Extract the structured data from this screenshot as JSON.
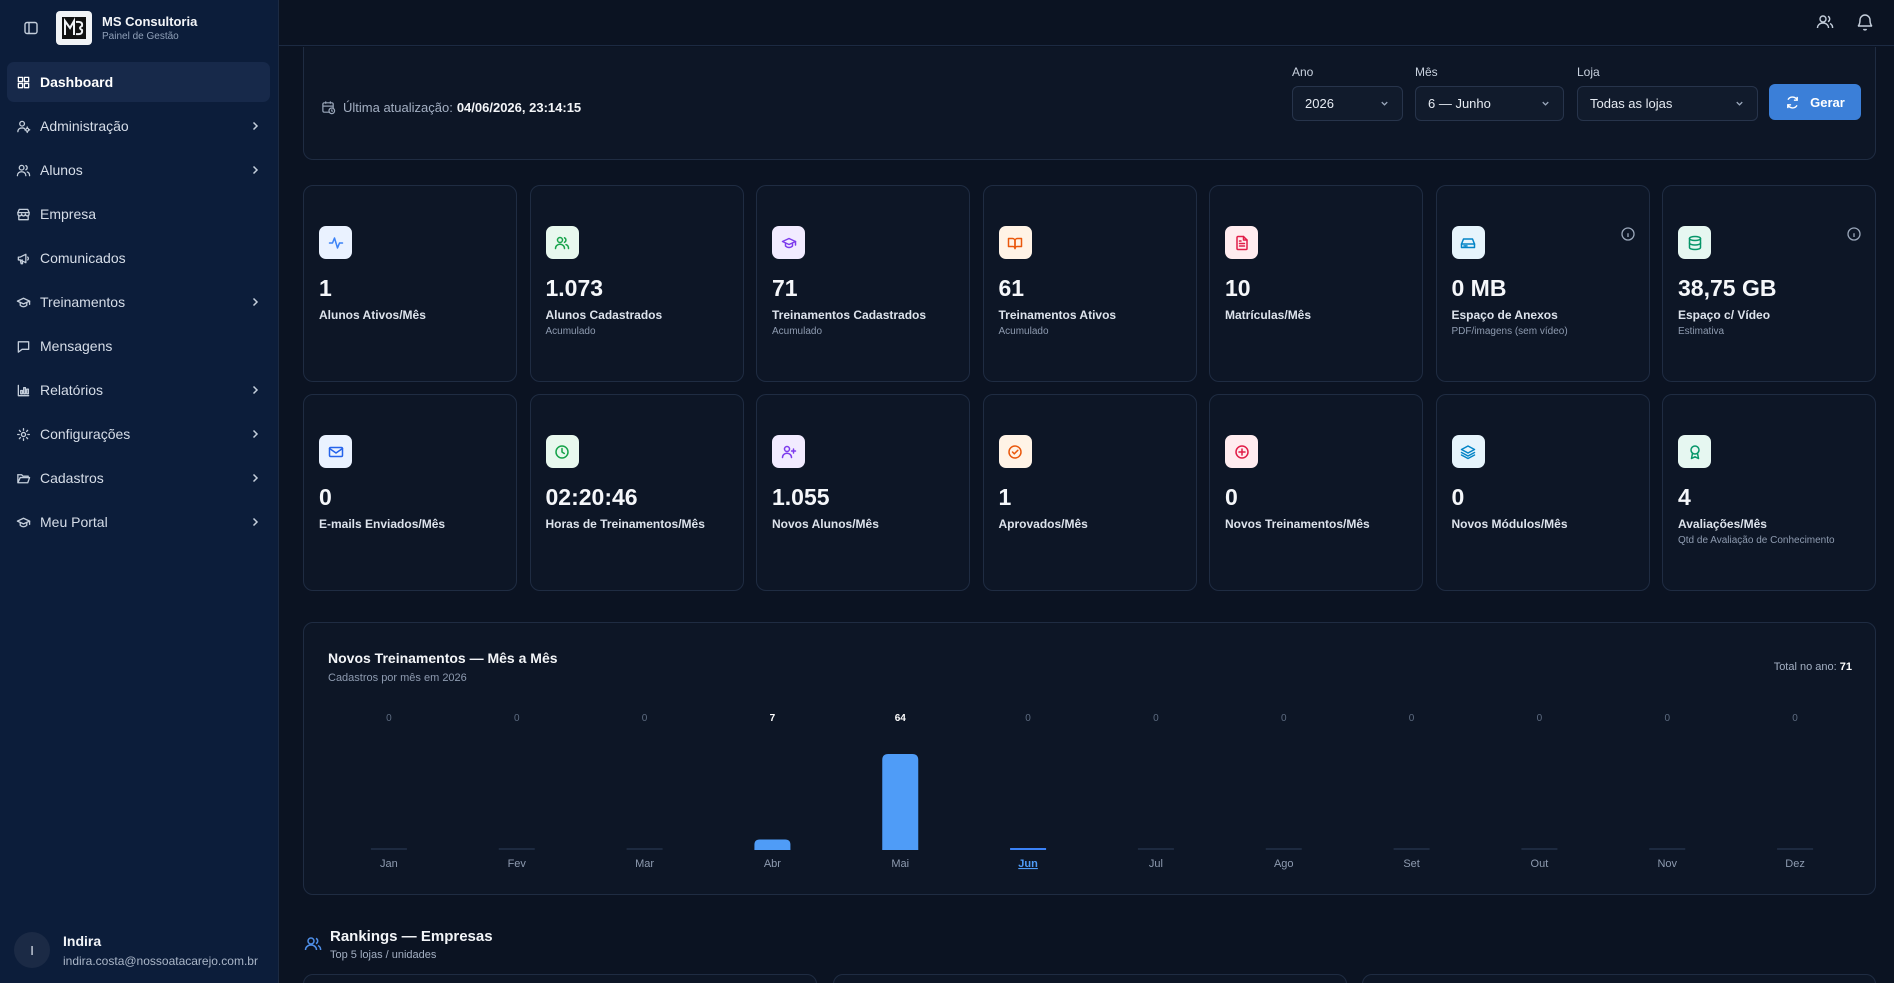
{
  "brand": {
    "title": "MS Consultoria",
    "subtitle": "Painel de Gestão"
  },
  "nav": [
    {
      "label": "Dashboard",
      "icon": "grid-icon",
      "active": true,
      "chevron": false
    },
    {
      "label": "Administração",
      "icon": "user-cog-icon",
      "chevron": true
    },
    {
      "label": "Alunos",
      "icon": "users-icon",
      "chevron": true
    },
    {
      "label": "Empresa",
      "icon": "store-icon",
      "chevron": false
    },
    {
      "label": "Comunicados",
      "icon": "megaphone-icon",
      "chevron": false
    },
    {
      "label": "Treinamentos",
      "icon": "graduation-cap-icon",
      "chevron": true
    },
    {
      "label": "Mensagens",
      "icon": "message-square-icon",
      "chevron": false
    },
    {
      "label": "Relatórios",
      "icon": "bar-chart-icon",
      "chevron": true
    },
    {
      "label": "Configurações",
      "icon": "gear-icon",
      "chevron": true
    },
    {
      "label": "Cadastros",
      "icon": "folder-open-icon",
      "chevron": true
    },
    {
      "label": "Meu Portal",
      "icon": "graduation-cap-icon",
      "chevron": true
    }
  ],
  "user": {
    "initial": "I",
    "name": "Indira",
    "email": "indira.costa@nossoatacarejo.com.br"
  },
  "filters": {
    "updated_label": "Última atualização:",
    "updated_value": "04/06/2026, 23:14:15",
    "ano": {
      "label": "Ano",
      "value": "2026"
    },
    "mes": {
      "label": "Mês",
      "value": "6 — Junho"
    },
    "loja": {
      "label": "Loja",
      "value": "Todas as lojas"
    },
    "gerar_label": "Gerar"
  },
  "stats": [
    {
      "value": "1",
      "label": "Alunos Ativos/Mês",
      "sub": "",
      "icon": "activity-icon",
      "color": "#3b82f6",
      "bg": "#eaf2ff"
    },
    {
      "value": "1.073",
      "label": "Alunos Cadastrados",
      "sub": "Acumulado",
      "icon": "users-icon",
      "color": "#16a34a",
      "bg": "#e8f8ee"
    },
    {
      "value": "71",
      "label": "Treinamentos Cadastrados",
      "sub": "Acumulado",
      "icon": "graduation-cap-icon",
      "color": "#7c3aed",
      "bg": "#f1ebff"
    },
    {
      "value": "61",
      "label": "Treinamentos Ativos",
      "sub": "Acumulado",
      "icon": "book-open-icon",
      "color": "#ea580c",
      "bg": "#fff3e6"
    },
    {
      "value": "10",
      "label": "Matrículas/Mês",
      "sub": "",
      "icon": "file-text-icon",
      "color": "#e11d48",
      "bg": "#ffecef"
    },
    {
      "value": "0 MB",
      "label": "Espaço de Anexos",
      "sub": "PDF/imagens (sem vídeo)",
      "icon": "hard-drive-icon",
      "color": "#0284c7",
      "bg": "#e6f4fc",
      "info": true
    },
    {
      "value": "38,75 GB",
      "label": "Espaço c/ Vídeo",
      "sub": "Estimativa",
      "icon": "database-icon",
      "color": "#059669",
      "bg": "#e6f7f1",
      "info": true
    },
    {
      "value": "0",
      "label": "E-mails Enviados/Mês",
      "sub": "",
      "icon": "mail-icon",
      "color": "#2563eb",
      "bg": "#eaf2ff"
    },
    {
      "value": "02:20:46",
      "label": "Horas de Treinamentos/Mês",
      "sub": "",
      "icon": "clock-icon",
      "color": "#16a34a",
      "bg": "#e8f8ee"
    },
    {
      "value": "1.055",
      "label": "Novos Alunos/Mês",
      "sub": "",
      "icon": "user-plus-icon",
      "color": "#7c3aed",
      "bg": "#f1ebff"
    },
    {
      "value": "1",
      "label": "Aprovados/Mês",
      "sub": "",
      "icon": "check-circle-icon",
      "color": "#ea580c",
      "bg": "#fff3e6"
    },
    {
      "value": "0",
      "label": "Novos Treinamentos/Mês",
      "sub": "",
      "icon": "plus-circle-icon",
      "color": "#e11d48",
      "bg": "#ffecef"
    },
    {
      "value": "0",
      "label": "Novos Módulos/Mês",
      "sub": "",
      "icon": "layers-icon",
      "color": "#0284c7",
      "bg": "#e6f4fc"
    },
    {
      "value": "4",
      "label": "Avaliações/Mês",
      "sub": "Qtd de Avaliação de Conhecimento",
      "icon": "award-icon",
      "color": "#059669",
      "bg": "#e6f7f1"
    }
  ],
  "chart_data": {
    "type": "bar",
    "title": "Novos Treinamentos — Mês a Mês",
    "subtitle": "Cadastros por mês em 2026",
    "total_label": "Total no ano:",
    "total_value": "71",
    "categories": [
      "Jan",
      "Fev",
      "Mar",
      "Abr",
      "Mai",
      "Jun",
      "Jul",
      "Ago",
      "Set",
      "Out",
      "Nov",
      "Dez"
    ],
    "values": [
      0,
      0,
      0,
      7,
      64,
      0,
      0,
      0,
      0,
      0,
      0,
      0
    ],
    "highlight": "Jun",
    "ylim": [
      0,
      64
    ],
    "bar_color": "#4f9cf7",
    "grid": false
  },
  "rankings": {
    "title": "Rankings — Empresas",
    "subtitle": "Top 5 lojas / unidades"
  }
}
